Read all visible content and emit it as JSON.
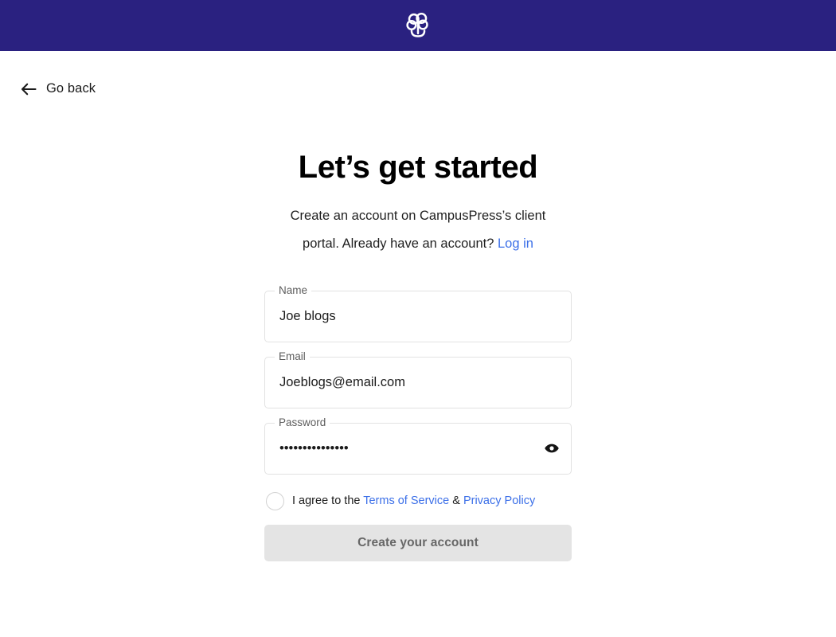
{
  "theme": {
    "header_bg": "#2a2180",
    "link_blue": "#3b6fe8",
    "button_bg": "#e4e4e4",
    "button_text": "#676767",
    "field_border": "#e2e2e2"
  },
  "header": {
    "logo_name": "campuspress-tree-logo"
  },
  "nav": {
    "back_label": "Go back",
    "back_icon": "arrow-left-icon"
  },
  "main": {
    "title": "Let’s get started",
    "subtitle_prefix": "Create an account on CampusPress’s client portal. Already have an account?",
    "login_link_label": "Log in"
  },
  "form": {
    "fields": [
      {
        "name": "name",
        "label": "Name",
        "value": "Joe blogs",
        "placeholder": "",
        "type": "text"
      },
      {
        "name": "email",
        "label": "Email",
        "value": "Joeblogs@email.com",
        "placeholder": "",
        "type": "text"
      },
      {
        "name": "password",
        "label": "Password",
        "value": "•••••••••••••••",
        "placeholder": "",
        "type": "password",
        "adornment_icon": "eye-icon"
      }
    ],
    "consent": {
      "checked": false,
      "text_prefix": "I agree to the",
      "terms_label": "Terms of Service",
      "separator": "&",
      "privacy_label": "Privacy Policy"
    },
    "submit_label": "Create your account"
  }
}
